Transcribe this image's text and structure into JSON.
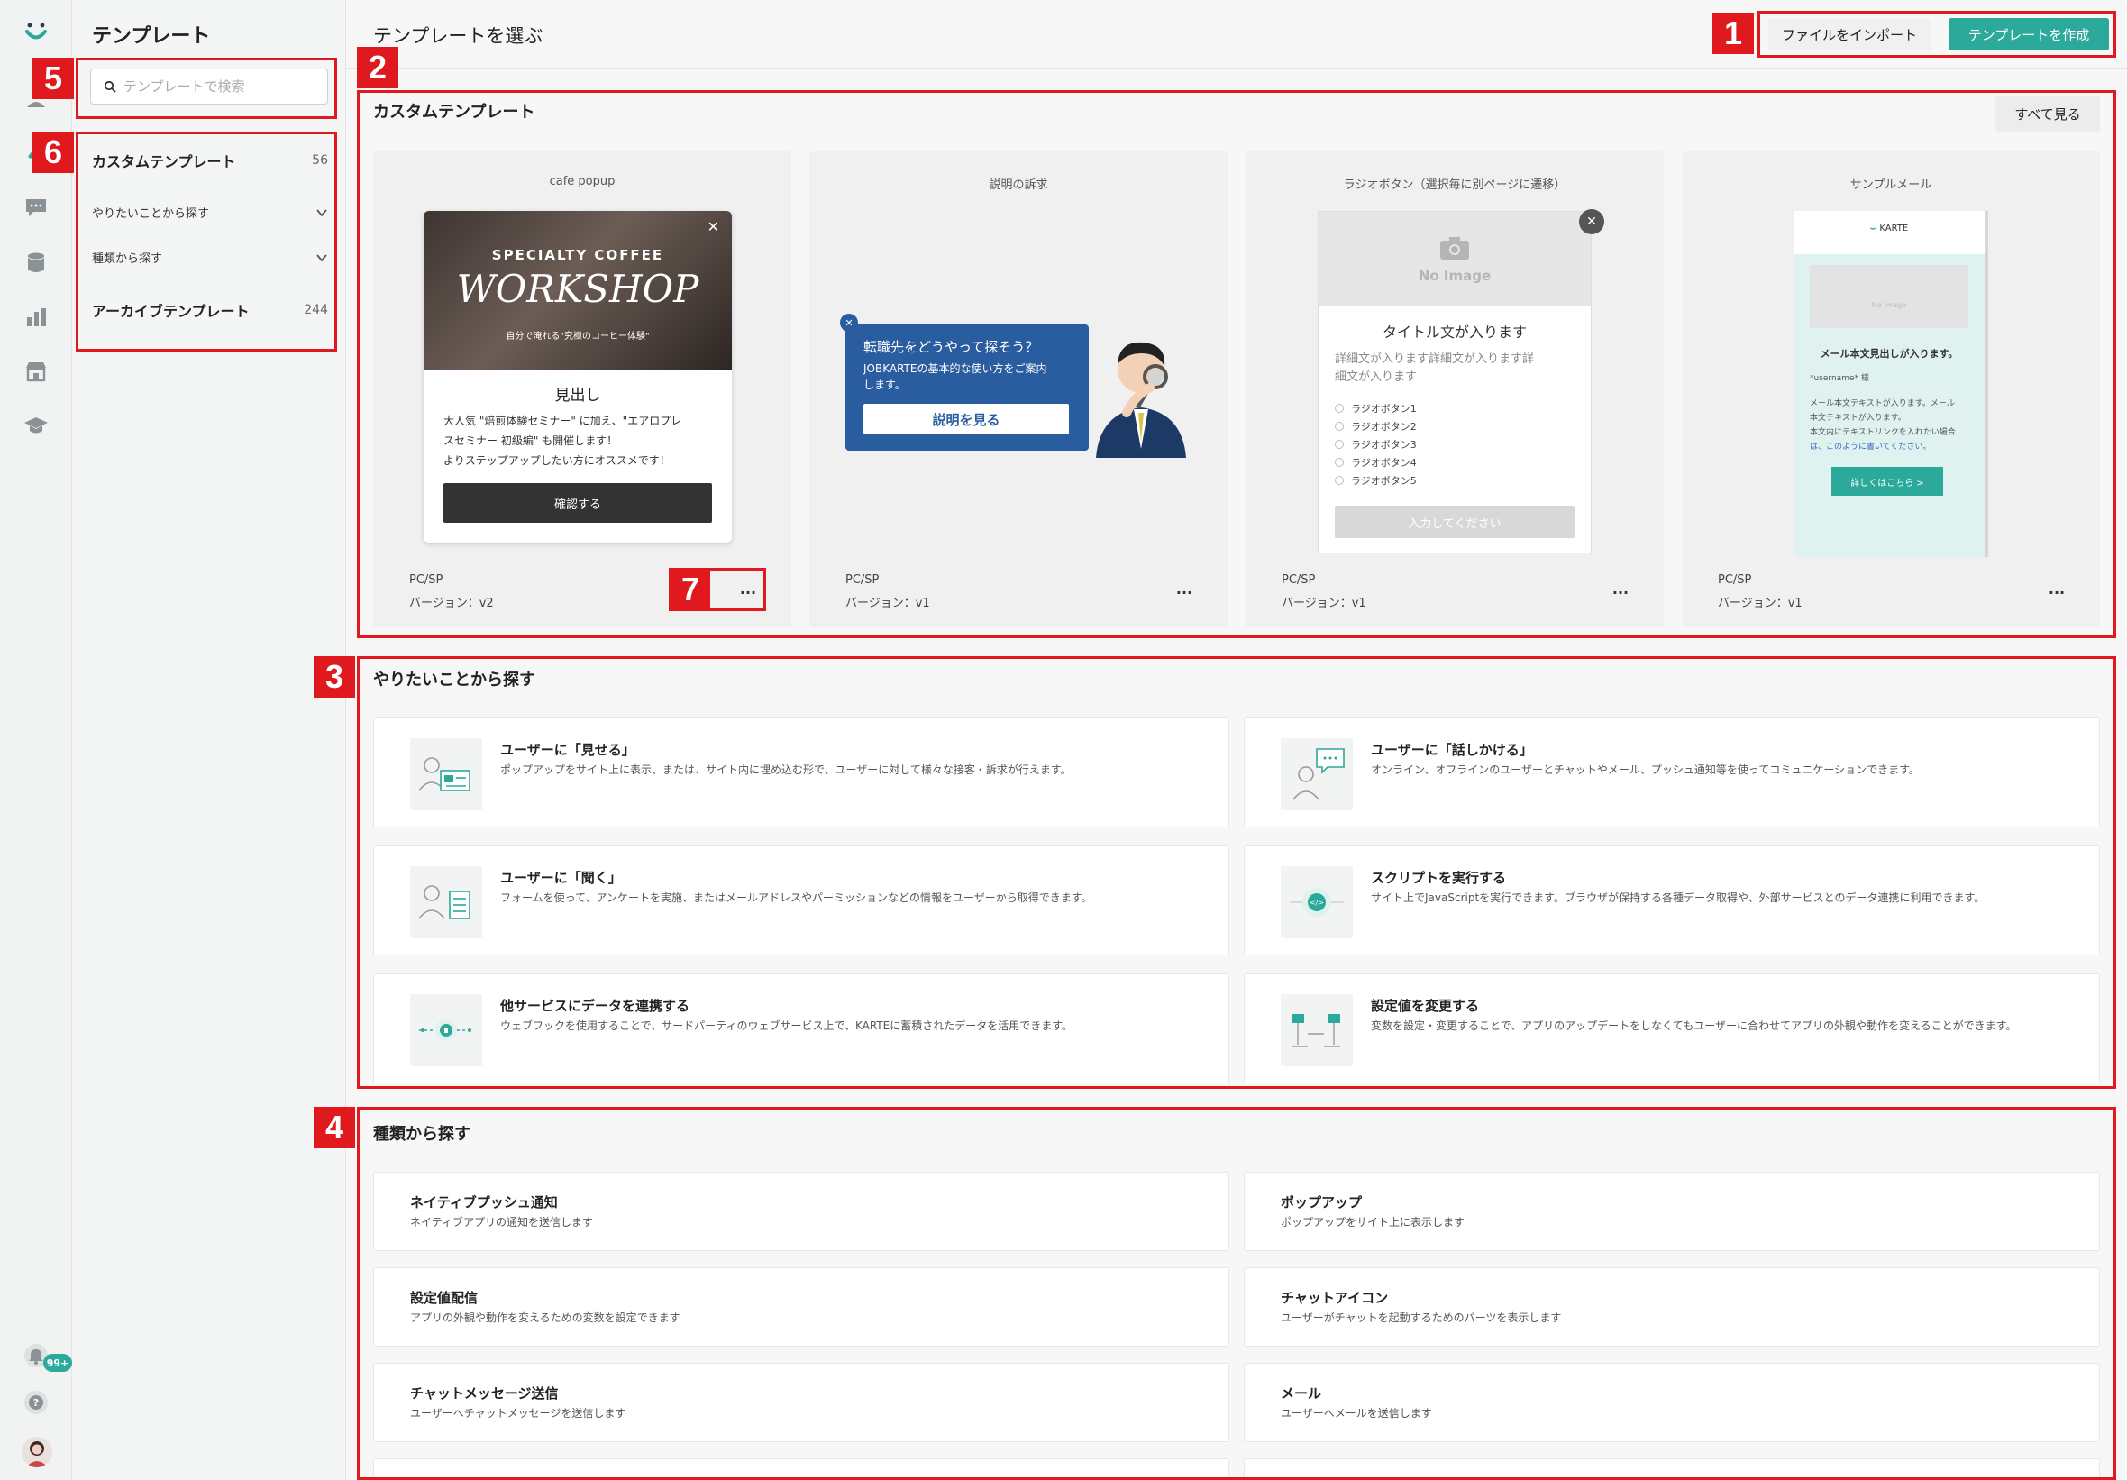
{
  "sidebar": {
    "title": "テンプレート",
    "search_placeholder": "テンプレートで検索",
    "nav": [
      {
        "label": "カスタムテンプレート",
        "count": "56"
      },
      {
        "label": "やりたいことから探す"
      },
      {
        "label": "種類から探す"
      },
      {
        "label": "アーカイブテンプレート",
        "count": "244"
      }
    ]
  },
  "rail": {
    "notification_badge": "99+"
  },
  "header": {
    "title": "テンプレートを選ぶ",
    "import_label": "ファイルをインポート",
    "create_label": "テンプレートを作成"
  },
  "custom": {
    "title": "カスタムテンプレート",
    "see_all": "すべて見る",
    "cards": [
      {
        "name": "cafe popup",
        "platform": "PC/SP",
        "version": "バージョン：v2",
        "more": "...",
        "preview": {
          "kicker": "SPECIALTY COFFEE",
          "headline": "WORKSHOP",
          "sub": "自分で淹れる\"究極のコーヒー体験\"",
          "heading": "見出し",
          "body1": "大人気 \"焙煎体験セミナー\" に加え、\"エアロプレ",
          "body2": "スセミナー 初級編\" も開催します！",
          "body3": "よりステップアップしたい方にオススメです！",
          "cta": "確認する"
        }
      },
      {
        "name": "説明の訴求",
        "platform": "PC/SP",
        "version": "バージョン：v1",
        "more": "...",
        "preview": {
          "q": "転職先をどうやって探そう？",
          "line1": "JOBKARTEの基本的な使い方をご案内",
          "line2": "します。",
          "cta": "説明を見る"
        }
      },
      {
        "name": "ラジオボタン（選択毎に別ページに遷移）",
        "platform": "PC/SP",
        "version": "バージョン：v1",
        "more": "...",
        "preview": {
          "noimage": "No Image",
          "title": "タイトル文が入ります",
          "d1": "詳細文が入ります詳細文が入ります詳",
          "d2": "細文が入ります",
          "options": [
            "ラジオボタン1",
            "ラジオボタン2",
            "ラジオボタン3",
            "ラジオボタン4",
            "ラジオボタン5"
          ],
          "cta": "入力してください"
        }
      },
      {
        "name": "サンプルメール",
        "platform": "PC/SP",
        "version": "バージョン：v1",
        "more": "...",
        "preview": {
          "brand": "KARTE",
          "noimage": "No Image",
          "heading": "メール本文見出しが入ります。",
          "greet": "*username* 様",
          "t1": "メール本文テキストが入ります。メール",
          "t2": "本文テキストが入ります。",
          "t3": "本文内にテキストリンクを入れたい場合",
          "t4": "は、このように書いてください。",
          "cta": "詳しくはこちら >"
        }
      }
    ]
  },
  "purpose": {
    "title": "やりたいことから探す",
    "items": [
      {
        "title": "ユーザーに「見せる」",
        "desc": "ポップアップをサイト上に表示、または、サイト内に埋め込む形で、ユーザーに対して様々な接客・訴求が行えます。"
      },
      {
        "title": "ユーザーに「話しかける」",
        "desc": "オンライン、オフラインのユーザーとチャットやメール、プッシュ通知等を使ってコミュニケーションできます。"
      },
      {
        "title": "ユーザーに「聞く」",
        "desc": "フォームを使って、アンケートを実施、またはメールアドレスやパーミッションなどの情報をユーザーから取得できます。"
      },
      {
        "title": "スクリプトを実行する",
        "desc": "サイト上でJavaScriptを実行できます。ブラウザが保持する各種データ取得や、外部サービスとのデータ連携に利用できます。"
      },
      {
        "title": "他サービスにデータを連携する",
        "desc": "ウェブフックを使用することで、サードパーティのウェブサービス上で、KARTEに蓄積されたデータを活用できます。"
      },
      {
        "title": "設定値を変更する",
        "desc": "変数を設定・変更することで、アプリのアップデートをしなくてもユーザーに合わせてアプリの外観や動作を変えることができます。"
      }
    ]
  },
  "types": {
    "title": "種類から探す",
    "items": [
      {
        "title": "ネイティブプッシュ通知",
        "desc": "ネイティブアプリの通知を送信します"
      },
      {
        "title": "ポップアップ",
        "desc": "ポップアップをサイト上に表示します"
      },
      {
        "title": "設定値配信",
        "desc": "アプリの外観や動作を変えるための変数を設定できます"
      },
      {
        "title": "チャットアイコン",
        "desc": "ユーザーがチャットを起動するためのパーツを表示します"
      },
      {
        "title": "チャットメッセージ送信",
        "desc": "ユーザーへチャットメッセージを送信します"
      },
      {
        "title": "メール",
        "desc": "ユーザーへメールを送信します"
      }
    ]
  },
  "annotations": [
    "1",
    "2",
    "3",
    "4",
    "5",
    "6",
    "7"
  ],
  "colors": {
    "accent": "#2ba99a",
    "annotation": "#e0191e"
  }
}
